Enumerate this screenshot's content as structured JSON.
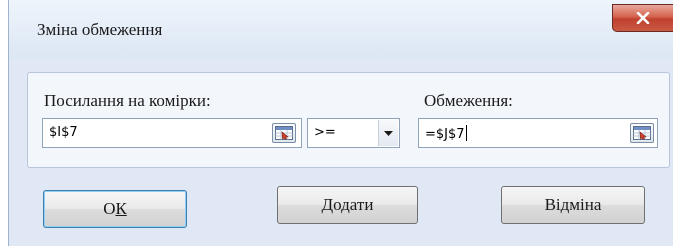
{
  "dialog": {
    "title": "Зміна обмеження",
    "close_icon": "close-icon"
  },
  "constraint": {
    "cell_ref_label": "Посилання на комірки:",
    "cell_ref_value": "$I$7",
    "operator_value": ">=",
    "constraint_label": "Обмеження:",
    "constraint_value": "=$J$7"
  },
  "buttons": {
    "ok_prefix": "О",
    "ok_hotkey": "К",
    "add": "Додати",
    "cancel": "Відміна"
  },
  "colors": {
    "dialog_bg": "#dfe8f4",
    "close_button": "#c0412d",
    "default_button_border": "#3c7fb1"
  }
}
